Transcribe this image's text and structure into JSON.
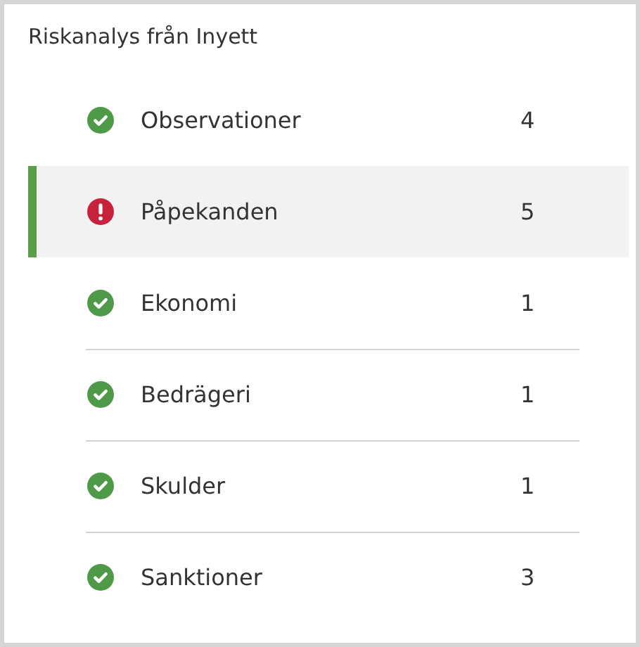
{
  "title": "Riskanalys från Inyett",
  "items": [
    {
      "label": "Observationer",
      "count": "4",
      "kind": "ok",
      "selected": false
    },
    {
      "label": "Påpekanden",
      "count": "5",
      "kind": "alert",
      "selected": true
    },
    {
      "label": "Ekonomi",
      "count": "1",
      "kind": "ok",
      "selected": false
    },
    {
      "label": "Bedrägeri",
      "count": "1",
      "kind": "ok",
      "selected": false
    },
    {
      "label": "Skulder",
      "count": "1",
      "kind": "ok",
      "selected": false
    },
    {
      "label": "Sanktioner",
      "count": "3",
      "kind": "ok",
      "selected": false
    }
  ]
}
